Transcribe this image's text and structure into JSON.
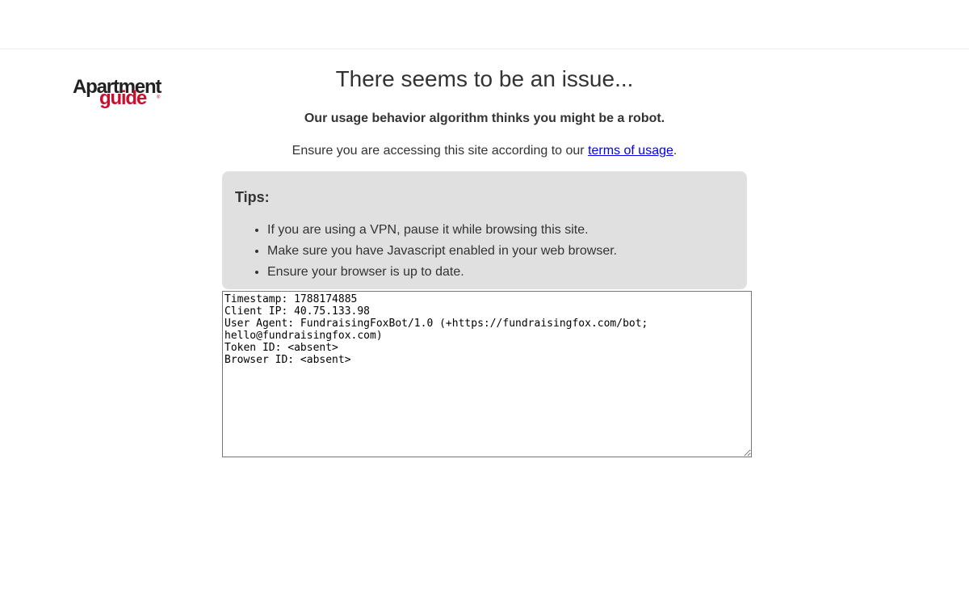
{
  "logo": {
    "line1": "Apartment",
    "line2": "guide",
    "reg": "®",
    "brand_red": "#c8102e"
  },
  "message": {
    "headline": "There seems to be an issue...",
    "subhead": "Our usage behavior algorithm thinks you might be a robot.",
    "terms_prefix": "Ensure you are accessing this site according to our ",
    "terms_link": "terms of usage",
    "terms_suffix": "."
  },
  "tips": {
    "title": "Tips:",
    "items": [
      "If you are using a VPN, pause it while browsing this site.",
      "Make sure you have Javascript enabled in your web browser.",
      "Ensure your browser is up to date."
    ]
  },
  "debug_info": {
    "text": "Timestamp: 1788174885\nClient IP: 40.75.133.98\nUser Agent: FundraisingFoxBot/1.0 (+https://fundraisingfox.com/bot; hello@fundraisingfox.com)\nToken ID: <absent>\nBrowser ID: <absent>"
  },
  "colors": {
    "text": "#333333",
    "link": "#0000ee",
    "tips_background": "#e0e0e0"
  }
}
